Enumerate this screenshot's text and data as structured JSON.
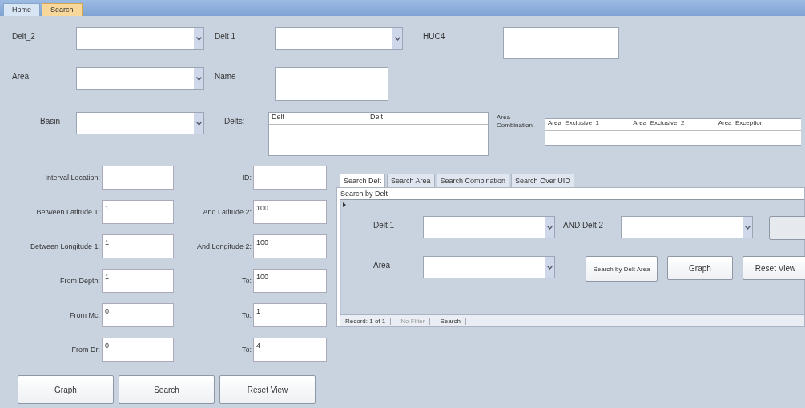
{
  "tabs": [
    {
      "label": "Home",
      "selected": false
    },
    {
      "label": "Search",
      "selected": true
    }
  ],
  "top": {
    "delt_2": {
      "label": "Delt_2"
    },
    "delt_1": {
      "label": "Delt 1"
    },
    "huc4": {
      "label": "HUC4"
    },
    "area": {
      "label": "Area"
    },
    "name": {
      "label": "Name"
    },
    "basin": {
      "label": "Basin"
    },
    "delts": {
      "label": "Delts:",
      "columns": [
        "Delt",
        "Delt"
      ]
    },
    "area_combination": {
      "label": "Area Combination",
      "columns": [
        "Area_Exclusive_1",
        "Area_Exclusive_2",
        "Area_Exception"
      ]
    }
  },
  "criteria": [
    {
      "label": "Interval Location:",
      "label_2": "ID:"
    },
    {
      "label": "Between Latitude 1:",
      "value": "1",
      "label_2": "And Latitude 2:",
      "value_2": "100"
    },
    {
      "label": "Between Longitude 1:",
      "value": "1",
      "label_2": "And Longitude 2:",
      "value_2": "100"
    },
    {
      "label": "From Depth:",
      "value": "1",
      "label_2": "To:",
      "value_2": "100"
    },
    {
      "label": "From Mc:",
      "value": "0",
      "label_2": "To:",
      "value_2": "1"
    },
    {
      "label": "From Dr:",
      "value": "0",
      "label_2": "To:",
      "value_2": "4"
    }
  ],
  "buttons": [
    "Graph",
    "Search",
    "Reset View"
  ],
  "subform": {
    "tabs": [
      {
        "label": "Search Delt",
        "selected": true
      },
      {
        "label": "Search Area",
        "selected": false
      },
      {
        "label": "Search Combination",
        "selected": false
      },
      {
        "label": "Search Over UID",
        "selected": false
      }
    ],
    "header": "Search by Delt",
    "delt_1": "Delt 1",
    "and_delt_2": "AND Delt 2",
    "area": "Area",
    "buttons": [
      "Search by Delt Area",
      "Graph",
      "Reset View"
    ],
    "nav": {
      "record": "Record: 1 of 1",
      "filter": "No Filter",
      "search": "Search"
    }
  }
}
